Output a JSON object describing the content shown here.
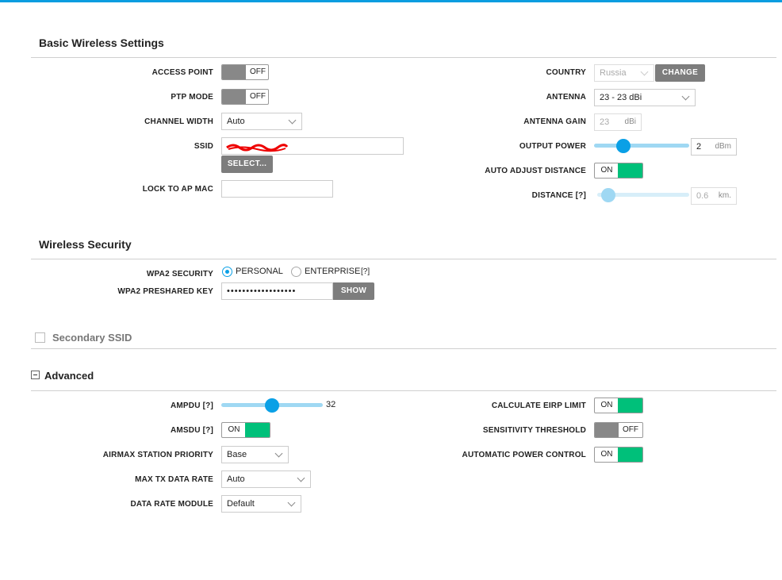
{
  "basic": {
    "title": "Basic Wireless Settings",
    "access_point": {
      "label": "ACCESS POINT",
      "state": "OFF"
    },
    "ptp_mode": {
      "label": "PTP MODE",
      "state": "OFF"
    },
    "channel_width": {
      "label": "CHANNEL WIDTH",
      "value": "Auto"
    },
    "ssid": {
      "label": "SSID",
      "select_label": "SELECT..."
    },
    "lock_to_ap_mac": {
      "label": "LOCK TO AP MAC",
      "value": ""
    },
    "country": {
      "label": "COUNTRY",
      "value": "Russia",
      "change_label": "CHANGE"
    },
    "antenna": {
      "label": "ANTENNA",
      "value": "23 - 23 dBi"
    },
    "antenna_gain": {
      "label": "ANTENNA GAIN",
      "value": "23",
      "unit": "dBi"
    },
    "output_power": {
      "label": "OUTPUT POWER",
      "value": "2",
      "unit": "dBm",
      "level": 0.27
    },
    "auto_adjust_distance": {
      "label": "AUTO ADJUST DISTANCE",
      "state": "ON"
    },
    "distance": {
      "label": "DISTANCE [?]",
      "value": "0.6",
      "unit": "km.",
      "level": 0.05
    }
  },
  "security": {
    "title": "Wireless Security",
    "wpa2_security": {
      "label": "WPA2 SECURITY",
      "option_personal": "PERSONAL",
      "option_enterprise": "ENTERPRISE",
      "help": "[?]"
    },
    "preshared_key": {
      "label": "WPA2 PRESHARED KEY",
      "value": "••••••••••••••••••",
      "show_label": "SHOW"
    }
  },
  "secondary": {
    "title": "Secondary SSID"
  },
  "advanced": {
    "title": "Advanced",
    "ampdu": {
      "label": "AMPDU [?]",
      "value": "32",
      "level": 0.5
    },
    "amsdu": {
      "label": "AMSDU [?]",
      "state": "ON"
    },
    "airmax_priority": {
      "label": "AIRMAX STATION PRIORITY",
      "value": "Base"
    },
    "max_tx_rate": {
      "label": "MAX TX DATA RATE",
      "value": "Auto"
    },
    "data_rate_module": {
      "label": "DATA RATE MODULE",
      "value": "Default"
    },
    "calc_eirp": {
      "label": "CALCULATE EIRP LIMIT",
      "state": "ON"
    },
    "sensitivity": {
      "label": "SENSITIVITY THRESHOLD",
      "state": "OFF"
    },
    "auto_power": {
      "label": "AUTOMATIC POWER CONTROL",
      "state": "ON"
    }
  },
  "colors": {
    "accent": "#0aa0e6",
    "on_green": "#00c07a",
    "off_gray": "#888888"
  }
}
